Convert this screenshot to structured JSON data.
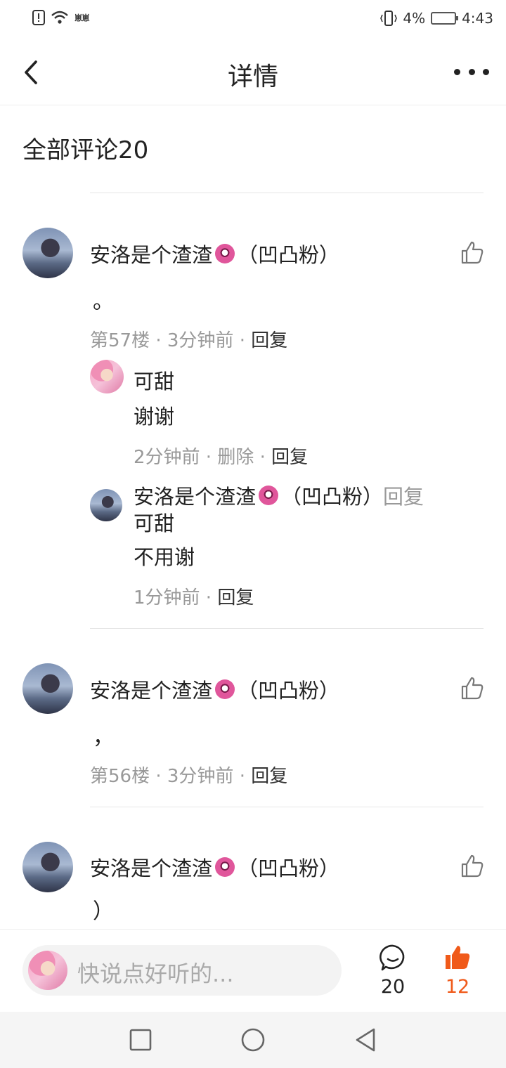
{
  "status_bar": {
    "network": "᠎崽崽",
    "battery_percent": "4%",
    "time": "4:43"
  },
  "header": {
    "title": "详情"
  },
  "comments_section": {
    "title": "全部评论20"
  },
  "comments": [
    {
      "author": "安洛是个渣渣",
      "author_suffix": "（凹凸粉）",
      "text": "。",
      "floor": "第57楼",
      "time": "3分钟前",
      "reply_label": "回复",
      "replies": [
        {
          "author": "可甜",
          "text": "谢谢",
          "time": "2分钟前",
          "delete_label": "删除",
          "reply_label": "回复"
        },
        {
          "author": "安洛是个渣渣",
          "author_suffix": "（凹凸粉）",
          "reply_word": "回复",
          "reply_target": "可甜",
          "text": "不用谢",
          "time": "1分钟前",
          "reply_label": "回复"
        }
      ]
    },
    {
      "author": "安洛是个渣渣",
      "author_suffix": "（凹凸粉）",
      "text": "，",
      "floor": "第56楼",
      "time": "3分钟前",
      "reply_label": "回复"
    },
    {
      "author": "安洛是个渣渣",
      "author_suffix": "（凹凸粉）",
      "text": "）"
    }
  ],
  "bottom_bar": {
    "input_placeholder": "快说点好听的...",
    "comment_count": "20",
    "like_count": "12"
  },
  "colors": {
    "accent": "#f05a1a",
    "meta_gray": "#999999"
  }
}
